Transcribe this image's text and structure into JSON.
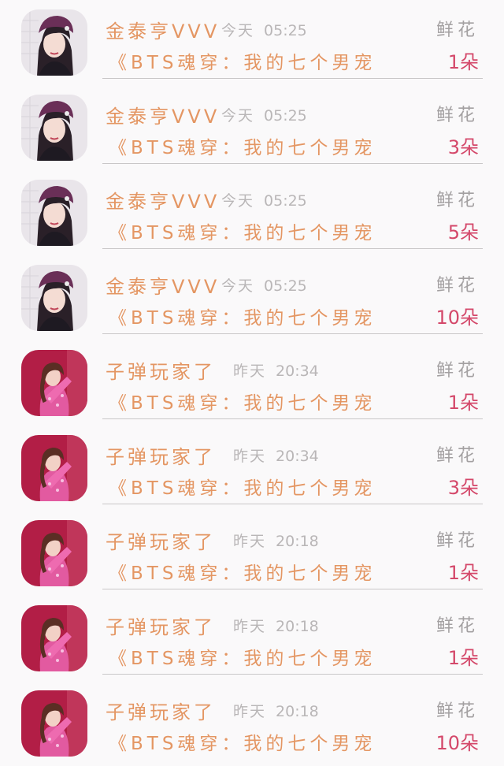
{
  "rows": [
    {
      "user": "金泰亨VVV",
      "day": "今天",
      "time": "05:25",
      "gift": "鲜花",
      "book": "《BTS魂穿：我的七个男宠",
      "amount": "1朵",
      "avatar": "avatar-beret-girl-icon"
    },
    {
      "user": "金泰亨VVV",
      "day": "今天",
      "time": "05:25",
      "gift": "鲜花",
      "book": "《BTS魂穿：我的七个男宠",
      "amount": "3朵",
      "avatar": "avatar-beret-girl-icon"
    },
    {
      "user": "金泰亨VVV",
      "day": "今天",
      "time": "05:25",
      "gift": "鲜花",
      "book": "《BTS魂穿：我的七个男宠",
      "amount": "5朵",
      "avatar": "avatar-beret-girl-icon"
    },
    {
      "user": "金泰亨VVV",
      "day": "今天",
      "time": "05:25",
      "gift": "鲜花",
      "book": "《BTS魂穿：我的七个男宠",
      "amount": "10朵",
      "avatar": "avatar-beret-girl-icon"
    },
    {
      "user": "子弹玩家了",
      "day": "昨天",
      "time": "20:34",
      "gift": "鲜花",
      "book": "《BTS魂穿：我的七个男宠",
      "amount": "1朵",
      "avatar": "avatar-pink-outfit-girl-icon"
    },
    {
      "user": "子弹玩家了",
      "day": "昨天",
      "time": "20:34",
      "gift": "鲜花",
      "book": "《BTS魂穿：我的七个男宠",
      "amount": "3朵",
      "avatar": "avatar-pink-outfit-girl-icon"
    },
    {
      "user": "子弹玩家了",
      "day": "昨天",
      "time": "20:18",
      "gift": "鲜花",
      "book": "《BTS魂穿：我的七个男宠",
      "amount": "1朵",
      "avatar": "avatar-pink-outfit-girl-icon"
    },
    {
      "user": "子弹玩家了",
      "day": "昨天",
      "time": "20:18",
      "gift": "鲜花",
      "book": "《BTS魂穿：我的七个男宠",
      "amount": "1朵",
      "avatar": "avatar-pink-outfit-girl-icon"
    },
    {
      "user": "子弹玩家了",
      "day": "昨天",
      "time": "20:18",
      "gift": "鲜花",
      "book": "《BTS魂穿：我的七个男宠",
      "amount": "10朵",
      "avatar": "avatar-pink-outfit-girl-icon"
    }
  ],
  "colors": {
    "background": "#faf9fa",
    "name_text": "#e49663",
    "book_text": "#e49663",
    "time_text": "#b9b6b7",
    "gift_label": "#a3a0a1",
    "amount_text": "#d4486a",
    "divider": "#c9c7c8"
  }
}
